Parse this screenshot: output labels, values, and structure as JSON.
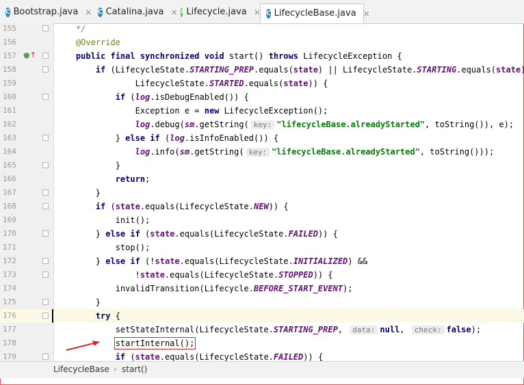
{
  "tabs": [
    {
      "label": "Bootstrap.java",
      "icon": "class-c-icon",
      "type": "c",
      "active": false
    },
    {
      "label": "Catalina.java",
      "icon": "class-c-icon",
      "type": "c",
      "active": false
    },
    {
      "label": "Lifecycle.java",
      "icon": "interface-i-icon",
      "type": "i",
      "active": false
    },
    {
      "label": "LifecycleBase.java",
      "icon": "class-c-icon",
      "type": "cl",
      "active": true
    }
  ],
  "tab_close_glyph": "×",
  "lines": [
    {
      "num": "155",
      "html": "    <span class='cm'>*/</span>"
    },
    {
      "num": "156",
      "html": "    <span class='an'>@Override</span>"
    },
    {
      "num": "157",
      "html": "    <span class='kw'>public final synchronized void</span> start() <span class='kw'>throws</span> LifecycleException {"
    },
    {
      "num": "158",
      "html": "        <span class='kw'>if</span> (LifecycleState.<span class='fd'>STARTING_PREP</span>.equals(<span class='vr'>state</span>) || LifecycleState.<span class='fd'>STARTING</span>.equals(<span class='vr'>state</span>) ||"
    },
    {
      "num": "159",
      "html": "                LifecycleState.<span class='fd'>STARTED</span>.equals(<span class='vr'>state</span>)) {"
    },
    {
      "num": "160",
      "html": "            <span class='kw'>if</span> (<span class='fd'>log</span>.isDebugEnabled()) {"
    },
    {
      "num": "161",
      "html": "                Exception e = <span class='kw'>new</span> LifecycleException();"
    },
    {
      "num": "162",
      "html": "                <span class='fd'>log</span>.debug(<span class='fd'>sm</span>.getString(<span class='hint'>key:</span><span class='st'>\"lifecycleBase.alreadyStarted\"</span>, toString()), e);"
    },
    {
      "num": "163",
      "html": "            } <span class='kw'>else if</span> (<span class='fd'>log</span>.isInfoEnabled()) {"
    },
    {
      "num": "164",
      "html": "                <span class='fd'>log</span>.info(<span class='fd'>sm</span>.getString(<span class='hint'>key:</span><span class='st'>\"lifecycleBase.alreadyStarted\"</span>, toString()));"
    },
    {
      "num": "165",
      "html": "            }"
    },
    {
      "num": "166",
      "html": "            <span class='kw'>return</span>;"
    },
    {
      "num": "167",
      "html": "        }"
    },
    {
      "num": "168",
      "html": "        <span class='kw'>if</span> (<span class='vr'>state</span>.equals(LifecycleState.<span class='fd'>NEW</span>)) {"
    },
    {
      "num": "169",
      "html": "            init();"
    },
    {
      "num": "170",
      "html": "        } <span class='kw'>else if</span> (<span class='vr'>state</span>.equals(LifecycleState.<span class='fd'>FAILED</span>)) {"
    },
    {
      "num": "171",
      "html": "            stop();"
    },
    {
      "num": "172",
      "html": "        } <span class='kw'>else if</span> (!<span class='vr'>state</span>.equals(LifecycleState.<span class='fd'>INITIALIZED</span>) &amp;&amp;"
    },
    {
      "num": "173",
      "html": "                !<span class='vr'>state</span>.equals(LifecycleState.<span class='fd'>STOPPED</span>)) {"
    },
    {
      "num": "174",
      "html": "            invalidTransition(Lifecycle.<span class='fd'>BEFORE_START_EVENT</span>);"
    },
    {
      "num": "175",
      "html": "        }"
    },
    {
      "num": "176",
      "html": "        <span class='kw'>try</span> {"
    },
    {
      "num": "177",
      "html": "            setStateInternal(LifecycleState.<span class='fd'>STARTING_PREP</span>, <span class='hint'>data:</span><span class='kw'>null</span>, <span class='hint'>check:</span><span class='kw'>false</span>);"
    },
    {
      "num": "178",
      "html": "            <span class='boxed'>startInternal();</span>"
    },
    {
      "num": "179",
      "html": "            <span class='kw'>if</span> (<span class='vr'>state</span>.equals(LifecycleState.<span class='fd'>FAILED</span>)) {"
    }
  ],
  "highlight_line": "176",
  "breadcrumb": {
    "class": "LifecycleBase",
    "separator": "›",
    "method": "start()"
  },
  "colors": {
    "keyword": "#000080",
    "annotation": "#808000",
    "string": "#008000",
    "field": "#660e7a",
    "comment": "#808080",
    "frame_border": "#e05555"
  }
}
